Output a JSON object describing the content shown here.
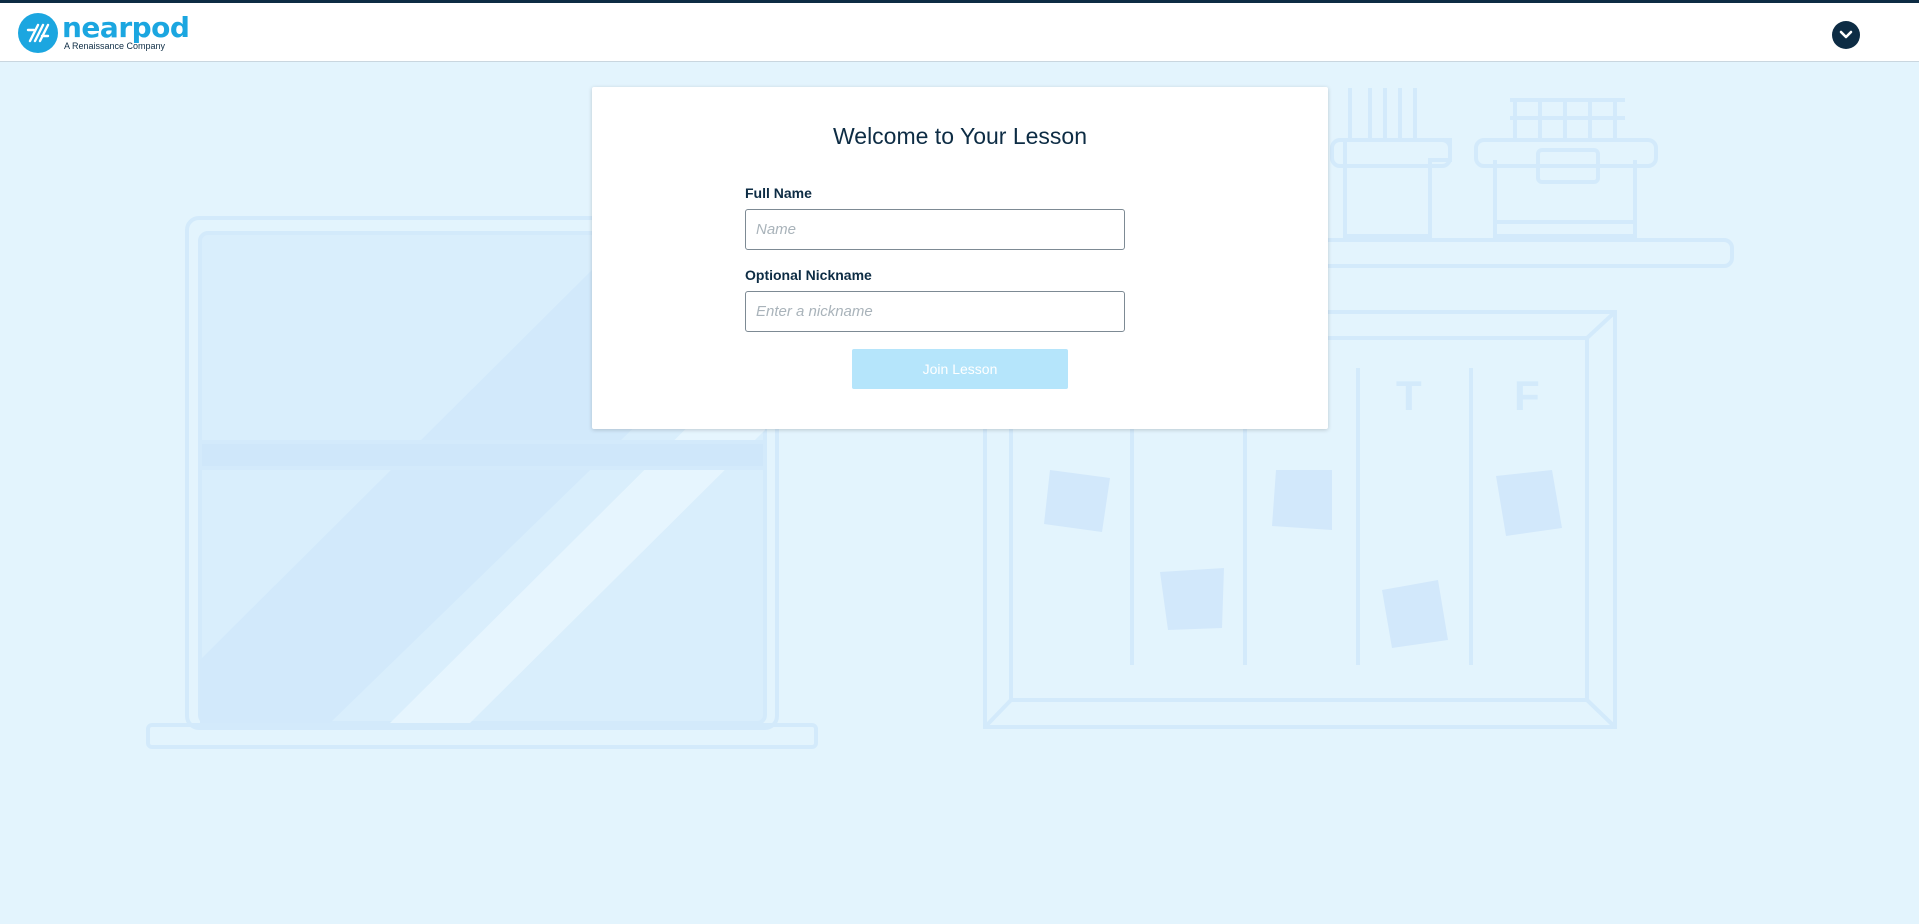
{
  "brand": {
    "name": "nearpod",
    "tagline": "A Renaissance Company",
    "logo_icon": "nearpod-logo-icon",
    "color": "#1ba6e0"
  },
  "header": {
    "menu_icon": "chevron-down-icon"
  },
  "background": {
    "board_letters": [
      "T",
      "F"
    ]
  },
  "form": {
    "title": "Welcome to Your Lesson",
    "full_name_label": "Full Name",
    "full_name_placeholder": "Name",
    "full_name_value": "",
    "nickname_label": "Optional Nickname",
    "nickname_placeholder": "Enter a nickname",
    "nickname_value": "",
    "submit_label": "Join Lesson",
    "submit_state": "disabled"
  },
  "colors": {
    "page_background": "#e3f4fd",
    "dark_navy": "#0d2c44",
    "button_disabled": "#b5e5fb"
  }
}
